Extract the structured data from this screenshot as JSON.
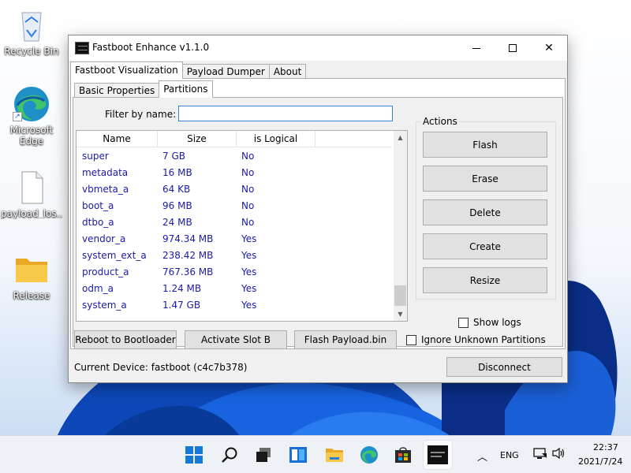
{
  "desktop": {
    "icons": [
      {
        "label": "Recycle Bin",
        "icon": "recycle-bin-icon"
      },
      {
        "label": "Microsoft Edge",
        "icon": "edge-icon"
      },
      {
        "label": "payload_los...",
        "icon": "file-icon"
      },
      {
        "label": "Release",
        "icon": "folder-icon"
      }
    ]
  },
  "window": {
    "title": "Fastboot Enhance v1.1.0",
    "controls": {
      "minimize": "—",
      "maximize": "☐",
      "close": "✕"
    },
    "tabs": [
      "Fastboot Visualization",
      "Payload Dumper",
      "About"
    ],
    "subtabs": [
      "Basic Properties",
      "Partitions"
    ],
    "filter": {
      "label": "Filter by name:",
      "value": ""
    },
    "table": {
      "columns": [
        "Name",
        "Size",
        "is Logical"
      ],
      "rows": [
        {
          "name": "super",
          "size": "7 GB",
          "logical": "No"
        },
        {
          "name": "metadata",
          "size": "16 MB",
          "logical": "No"
        },
        {
          "name": "vbmeta_a",
          "size": "64 KB",
          "logical": "No"
        },
        {
          "name": "boot_a",
          "size": "96 MB",
          "logical": "No"
        },
        {
          "name": "dtbo_a",
          "size": "24 MB",
          "logical": "No"
        },
        {
          "name": "vendor_a",
          "size": "974.34 MB",
          "logical": "Yes"
        },
        {
          "name": "system_ext_a",
          "size": "238.42 MB",
          "logical": "Yes"
        },
        {
          "name": "product_a",
          "size": "767.36 MB",
          "logical": "Yes"
        },
        {
          "name": "odm_a",
          "size": "1.24 MB",
          "logical": "Yes"
        },
        {
          "name": "system_a",
          "size": "1.47 GB",
          "logical": "Yes"
        }
      ]
    },
    "actions": {
      "title": "Actions",
      "buttons": [
        "Flash",
        "Erase",
        "Delete",
        "Create",
        "Resize"
      ]
    },
    "show_logs": {
      "label": "Show logs",
      "checked": false
    },
    "bottom": {
      "reboot": "Reboot to Bootloader",
      "activate": "Activate Slot B",
      "flash_payload": "Flash Payload.bin",
      "ignore_unknown": {
        "label": "Ignore Unknown Partitions",
        "checked": false
      },
      "device": "Current Device: fastboot (c4c7b378)",
      "disconnect": "Disconnect"
    }
  },
  "taskbar": {
    "icons": [
      "windows-start-icon",
      "search-icon",
      "task-view-icon",
      "widgets-icon",
      "file-explorer-icon",
      "edge-icon",
      "store-icon",
      "fastboot-enhance-icon"
    ],
    "tray": {
      "lang": "ENG",
      "time": "22:37",
      "date": "2021/7/24"
    }
  }
}
